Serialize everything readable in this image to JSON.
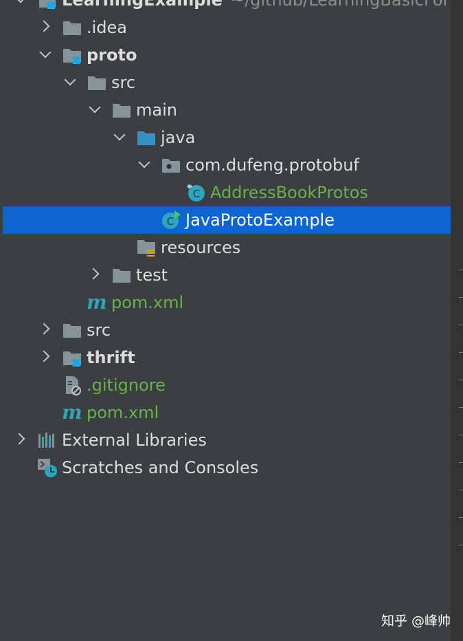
{
  "project": {
    "name": "LearningExample",
    "path": "~/github/LearningBasicFor"
  },
  "tree": [
    {
      "id": "idea",
      "label": ".idea",
      "indent": 1,
      "arrow": "right",
      "icon": "folder-icon",
      "style": "normal"
    },
    {
      "id": "proto",
      "label": "proto",
      "indent": 1,
      "arrow": "down",
      "icon": "module-folder-icon",
      "style": "bold"
    },
    {
      "id": "proto-src",
      "label": "src",
      "indent": 2,
      "arrow": "down",
      "icon": "folder-icon",
      "style": "normal"
    },
    {
      "id": "main",
      "label": "main",
      "indent": 3,
      "arrow": "down",
      "icon": "folder-icon",
      "style": "normal"
    },
    {
      "id": "java",
      "label": "java",
      "indent": 4,
      "arrow": "down",
      "icon": "source-root-folder-icon",
      "style": "normal"
    },
    {
      "id": "package",
      "label": "com.dufeng.protobuf",
      "indent": 5,
      "arrow": "down",
      "icon": "package-icon",
      "style": "normal"
    },
    {
      "id": "addressbook",
      "label": "AddressBookProtos",
      "indent": 6,
      "arrow": "none",
      "icon": "generated-class-icon",
      "style": "green"
    },
    {
      "id": "javaproto",
      "label": "JavaProtoExample",
      "indent": 5,
      "arrow": "none",
      "icon": "runnable-class-icon",
      "style": "selected"
    },
    {
      "id": "resources",
      "label": "resources",
      "indent": 4,
      "arrow": "none",
      "icon": "resources-folder-icon",
      "style": "normal"
    },
    {
      "id": "test",
      "label": "test",
      "indent": 3,
      "arrow": "right",
      "icon": "folder-icon",
      "style": "normal"
    },
    {
      "id": "proto-pom",
      "label": "pom.xml",
      "indent": 2,
      "arrow": "none",
      "icon": "maven-icon",
      "style": "green"
    },
    {
      "id": "src",
      "label": "src",
      "indent": 1,
      "arrow": "right",
      "icon": "folder-icon",
      "style": "normal"
    },
    {
      "id": "thrift",
      "label": "thrift",
      "indent": 1,
      "arrow": "right",
      "icon": "module-folder-icon",
      "style": "bold"
    },
    {
      "id": "gitignore",
      "label": ".gitignore",
      "indent": 1,
      "arrow": "none",
      "icon": "ignored-file-icon",
      "style": "green"
    },
    {
      "id": "root-pom",
      "label": "pom.xml",
      "indent": 1,
      "arrow": "none",
      "icon": "maven-icon",
      "style": "green"
    },
    {
      "id": "external",
      "label": "External Libraries",
      "indent": 0,
      "arrow": "right",
      "icon": "libraries-icon",
      "style": "normal"
    },
    {
      "id": "scratches",
      "label": "Scratches and Consoles",
      "indent": 0,
      "arrow": "none",
      "icon": "scratches-icon",
      "style": "normal"
    }
  ],
  "watermark": "知乎 @峰帅",
  "colors": {
    "background": "#3c3f41",
    "selection": "#0d64d4",
    "folder": "#87939a",
    "source_root": "#3592c4",
    "module_badge": "#1fa7e0",
    "green_text": "#6ab04c",
    "class_icon": "#2fa4bf"
  }
}
